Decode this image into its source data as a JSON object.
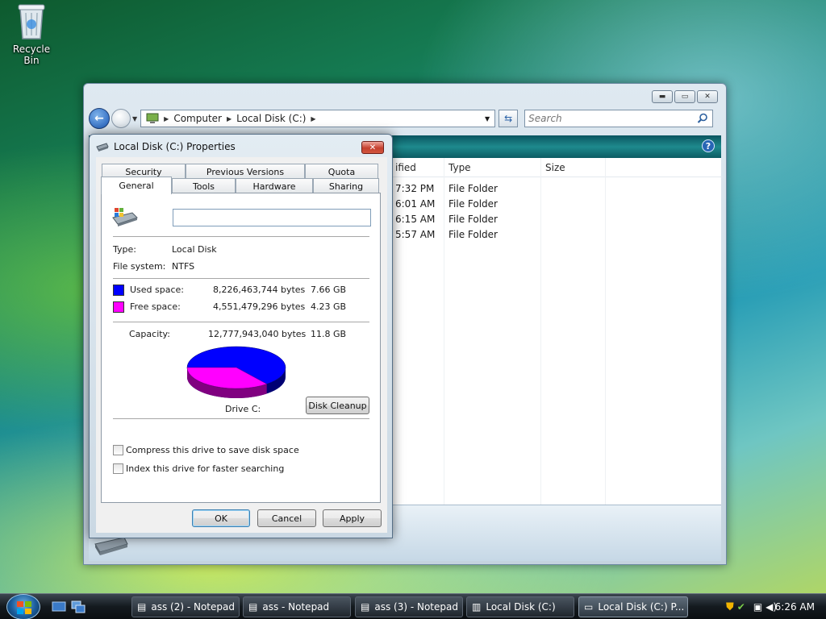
{
  "desktop": {
    "recycle_bin_label": "Recycle Bin"
  },
  "explorer": {
    "breadcrumb": [
      "Computer",
      "Local Disk (C:)"
    ],
    "search_placeholder": "Search",
    "columns": {
      "modified": "ified",
      "type": "Type",
      "size": "Size"
    },
    "rows": [
      {
        "time": "7:32 PM",
        "type": "File Folder"
      },
      {
        "time": "6:01 AM",
        "type": "File Folder"
      },
      {
        "time": "6:15 AM",
        "type": "File Folder"
      },
      {
        "time": "5:57 AM",
        "type": "File Folder"
      }
    ]
  },
  "dialog": {
    "title": "Local Disk (C:) Properties",
    "tabs_top": [
      "Security",
      "Previous Versions",
      "Quota"
    ],
    "tabs_bottom": [
      "General",
      "Tools",
      "Hardware",
      "Sharing"
    ],
    "active_tab": "General",
    "name_value": "",
    "type_label": "Type:",
    "type_value": "Local Disk",
    "fs_label": "File system:",
    "fs_value": "NTFS",
    "used_label": "Used space:",
    "used_bytes": "8,226,463,744 bytes",
    "used_gb": "7.66 GB",
    "free_label": "Free space:",
    "free_bytes": "4,551,479,296 bytes",
    "free_gb": "4.23 GB",
    "capacity_label": "Capacity:",
    "capacity_bytes": "12,777,943,040 bytes",
    "capacity_gb": "11.8 GB",
    "used_fraction": 0.644,
    "used_color": "#0000ff",
    "free_color": "#ff00ff",
    "drive_label": "Drive C:",
    "disk_cleanup_label": "Disk Cleanup",
    "compress_label": "Compress this drive to save disk space",
    "index_label": "Index this drive for faster searching",
    "ok_label": "OK",
    "cancel_label": "Cancel",
    "apply_label": "Apply"
  },
  "taskbar": {
    "tasks": [
      "ass (2) - Notepad",
      "ass - Notepad",
      "ass (3) - Notepad",
      "Local Disk (C:)",
      "Local Disk (C:) P..."
    ],
    "clock": "6:26 AM"
  }
}
